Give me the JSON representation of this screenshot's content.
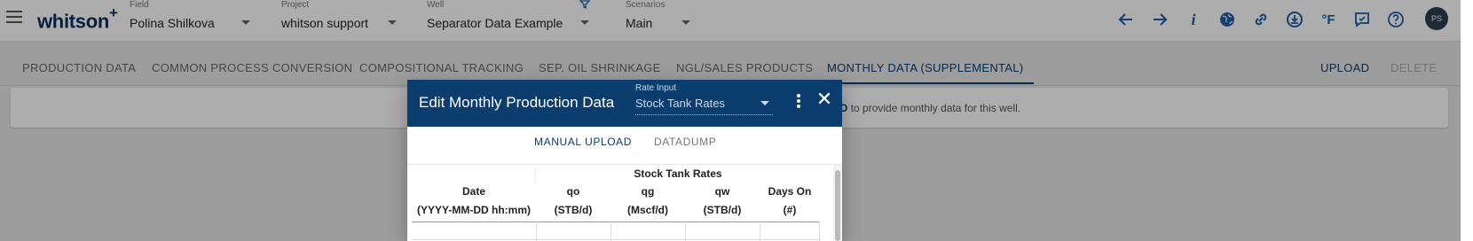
{
  "header": {
    "logo": "whitson",
    "logo_plus": "+",
    "field": {
      "label": "Field",
      "value": "Polina Shilkova"
    },
    "project": {
      "label": "Project",
      "value": "whitson support"
    },
    "well": {
      "label": "Well",
      "value": "Separator Data Example"
    },
    "scenarios": {
      "label": "Scenarios",
      "value": "Main"
    },
    "icons": [
      "arrow-left-icon",
      "arrow-right-icon",
      "info-icon",
      "globe-icon",
      "link-icon",
      "download-icon",
      "fahrenheit-icon",
      "feedback-icon",
      "help-icon"
    ],
    "fahrenheit": "°F",
    "info": "i",
    "avatar": "PS"
  },
  "tabs": [
    {
      "label": "PRODUCTION DATA",
      "active": false
    },
    {
      "label": "COMMON PROCESS CONVERSION",
      "active": false
    },
    {
      "label": "COMPOSITIONAL TRACKING",
      "active": false
    },
    {
      "label": "SEP. OIL SHRINKAGE",
      "active": false
    },
    {
      "label": "NGL/SALES PRODUCTS",
      "active": false
    },
    {
      "label": "MONTHLY DATA (SUPPLEMENTAL)",
      "active": true
    }
  ],
  "actions": {
    "upload": "UPLOAD",
    "delete": "DELETE"
  },
  "info_card": {
    "highlight": "AD",
    "text": " to provide monthly data for this well."
  },
  "dialog": {
    "title": "Edit Monthly Production Data",
    "rate_input_label": "Rate Input",
    "rate_input_value": "Stock Tank Rates",
    "tabs": {
      "manual": "MANUAL UPLOAD",
      "datadump": "DATADUMP"
    },
    "table": {
      "group_header": "Stock Tank Rates",
      "columns": [
        {
          "name": "Date",
          "unit": "(YYYY-MM-DD hh:mm)"
        },
        {
          "name": "qo",
          "unit": "(STB/d)"
        },
        {
          "name": "qg",
          "unit": "(Mscf/d)"
        },
        {
          "name": "qw",
          "unit": "(STB/d)"
        },
        {
          "name": "Days On",
          "unit": "(#)"
        }
      ]
    }
  },
  "colors": {
    "primary": "#0b3d6e",
    "accent": "#1a5da8"
  }
}
